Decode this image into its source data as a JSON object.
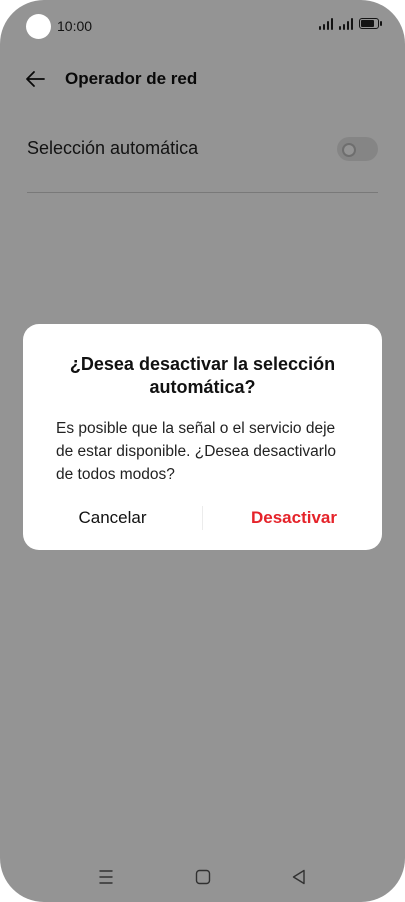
{
  "status_bar": {
    "time": "10:00",
    "icons": [
      "signal-icon",
      "signal-icon",
      "battery-icon"
    ]
  },
  "header": {
    "back_icon": "arrow-left-icon",
    "title": "Operador de red"
  },
  "settings": {
    "auto_selection": {
      "label": "Selección automática",
      "enabled": false
    }
  },
  "dialog": {
    "title": "¿Desea desactivar la selección automática?",
    "message": "Es posible que la señal o el servicio deje de estar disponible. ¿Desea desactivarlo de todos modos?",
    "cancel_label": "Cancelar",
    "confirm_label": "Desactivar",
    "confirm_color": "#e5232a"
  },
  "nav_bar": {
    "buttons": [
      "menu-icon",
      "home-icon",
      "back-triangle-icon"
    ]
  }
}
